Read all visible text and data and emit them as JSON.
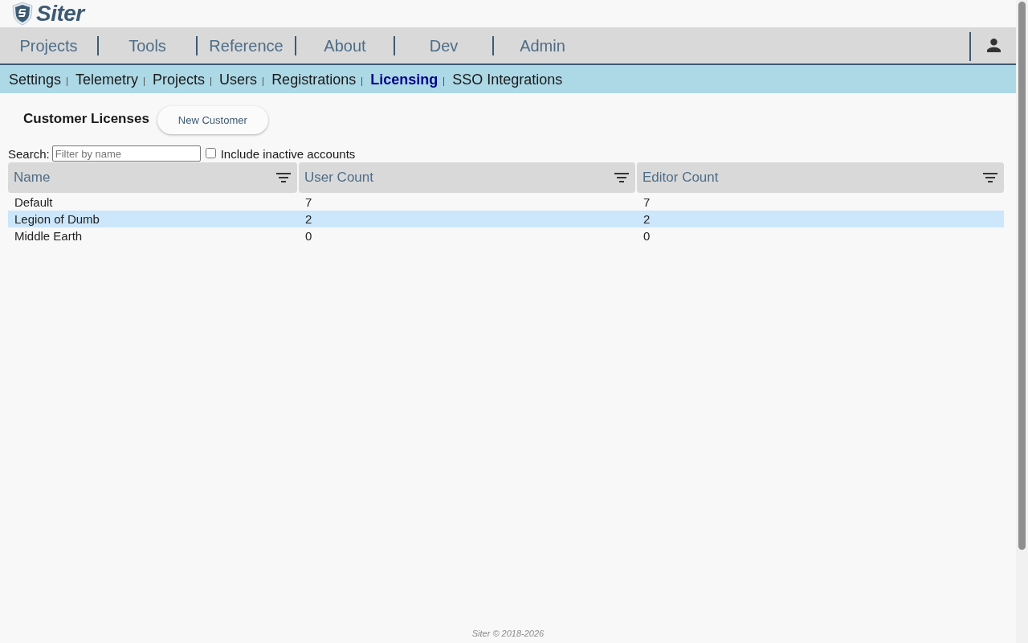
{
  "brand": {
    "name": "Siter"
  },
  "main_nav": {
    "items": [
      {
        "label": "Projects"
      },
      {
        "label": "Tools"
      },
      {
        "label": "Reference"
      },
      {
        "label": "About"
      },
      {
        "label": "Dev"
      },
      {
        "label": "Admin"
      }
    ]
  },
  "sub_nav": {
    "items": [
      {
        "label": "Settings",
        "selected": false
      },
      {
        "label": "Telemetry",
        "selected": false
      },
      {
        "label": "Projects",
        "selected": false
      },
      {
        "label": "Users",
        "selected": false
      },
      {
        "label": "Registrations",
        "selected": false
      },
      {
        "label": "Licensing",
        "selected": true
      },
      {
        "label": "SSO Integrations",
        "selected": false
      }
    ]
  },
  "page": {
    "title": "Customer Licenses",
    "new_button": "New Customer"
  },
  "search": {
    "label": "Search:",
    "placeholder": "Filter by name",
    "include_inactive": {
      "label": "Include inactive accounts",
      "checked": false
    }
  },
  "table": {
    "columns": [
      "Name",
      "User Count",
      "Editor Count"
    ],
    "rows": [
      {
        "cells": [
          "Default",
          "7",
          "7"
        ],
        "selected": false
      },
      {
        "cells": [
          "Legion of Dumb",
          "2",
          "2"
        ],
        "selected": true
      },
      {
        "cells": [
          "Middle Earth",
          "0",
          "0"
        ],
        "selected": false
      }
    ]
  },
  "footer": "Siter © 2018-2026"
}
